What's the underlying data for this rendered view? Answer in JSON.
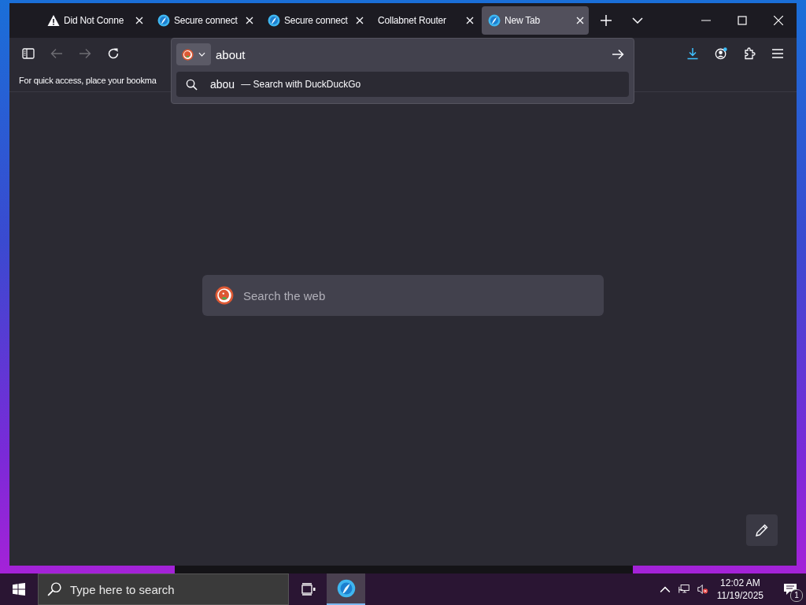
{
  "tabs": [
    {
      "kind": "warning",
      "title": "Did Not Conne",
      "selected": false
    },
    {
      "kind": "site",
      "title": "Secure connect",
      "selected": false
    },
    {
      "kind": "site",
      "title": "Secure connect",
      "selected": false
    },
    {
      "kind": "plain",
      "title": "Collabnet Router",
      "selected": false
    },
    {
      "kind": "site",
      "title": "New Tab",
      "selected": true
    }
  ],
  "bookmarks_bar": {
    "hint": "For quick access, place your bookma"
  },
  "address_bar": {
    "value": "about",
    "suggestions": [
      {
        "query": "abou",
        "action": "— Search with DuckDuckGo"
      }
    ]
  },
  "new_tab_page": {
    "search": {
      "placeholder": "Search the web"
    }
  },
  "taskbar": {
    "search": {
      "placeholder": "Type here to search"
    },
    "time": "12:02 AM",
    "date": "11/19/2025",
    "notifications": "1"
  }
}
